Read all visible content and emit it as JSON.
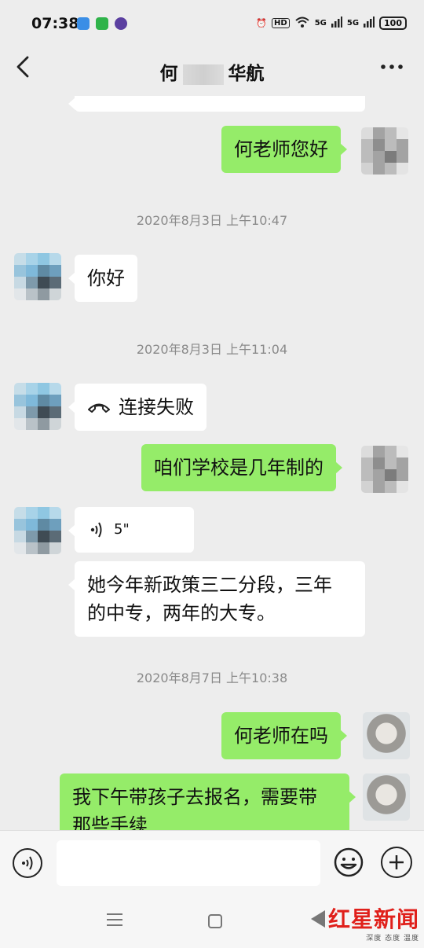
{
  "status_bar": {
    "time": "07:38",
    "hd": "HD",
    "net1": "5G",
    "net2": "5G",
    "battery": "100"
  },
  "header": {
    "title_left": "何",
    "title_right": "华航",
    "back_icon": "chevron-left-icon",
    "more_icon": "ellipsis-icon"
  },
  "messages": {
    "m1": {
      "side": "right",
      "text": "何老师您好"
    },
    "ts1": "2020年8月3日 上午10:47",
    "m2": {
      "side": "left",
      "text": "你好"
    },
    "ts2": "2020年8月3日 上午11:04",
    "m3": {
      "side": "left",
      "text": "连接失败",
      "icon": "phone-hangup-icon"
    },
    "m4": {
      "side": "right",
      "text": "咱们学校是几年制的"
    },
    "m5": {
      "side": "left",
      "voice_duration": "5\"",
      "icon": "voice-icon"
    },
    "m6": {
      "side": "left",
      "line1": "她今年新政策三二分段，三年",
      "line2": "的中专，两年的大专。"
    },
    "ts3": "2020年8月7日 上午10:38",
    "m7": {
      "side": "right",
      "text": "何老师在吗"
    },
    "m8": {
      "side": "right",
      "line1": "我下午带孩子去报名，需要带",
      "line2": "那些手续"
    }
  },
  "input_bar": {
    "placeholder": ""
  },
  "watermark": {
    "main": "红星新闻",
    "sub": "深度 态度 温度"
  },
  "colors": {
    "bubble_green": "#95ec69",
    "bubble_white": "#ffffff",
    "background": "#ededed"
  }
}
